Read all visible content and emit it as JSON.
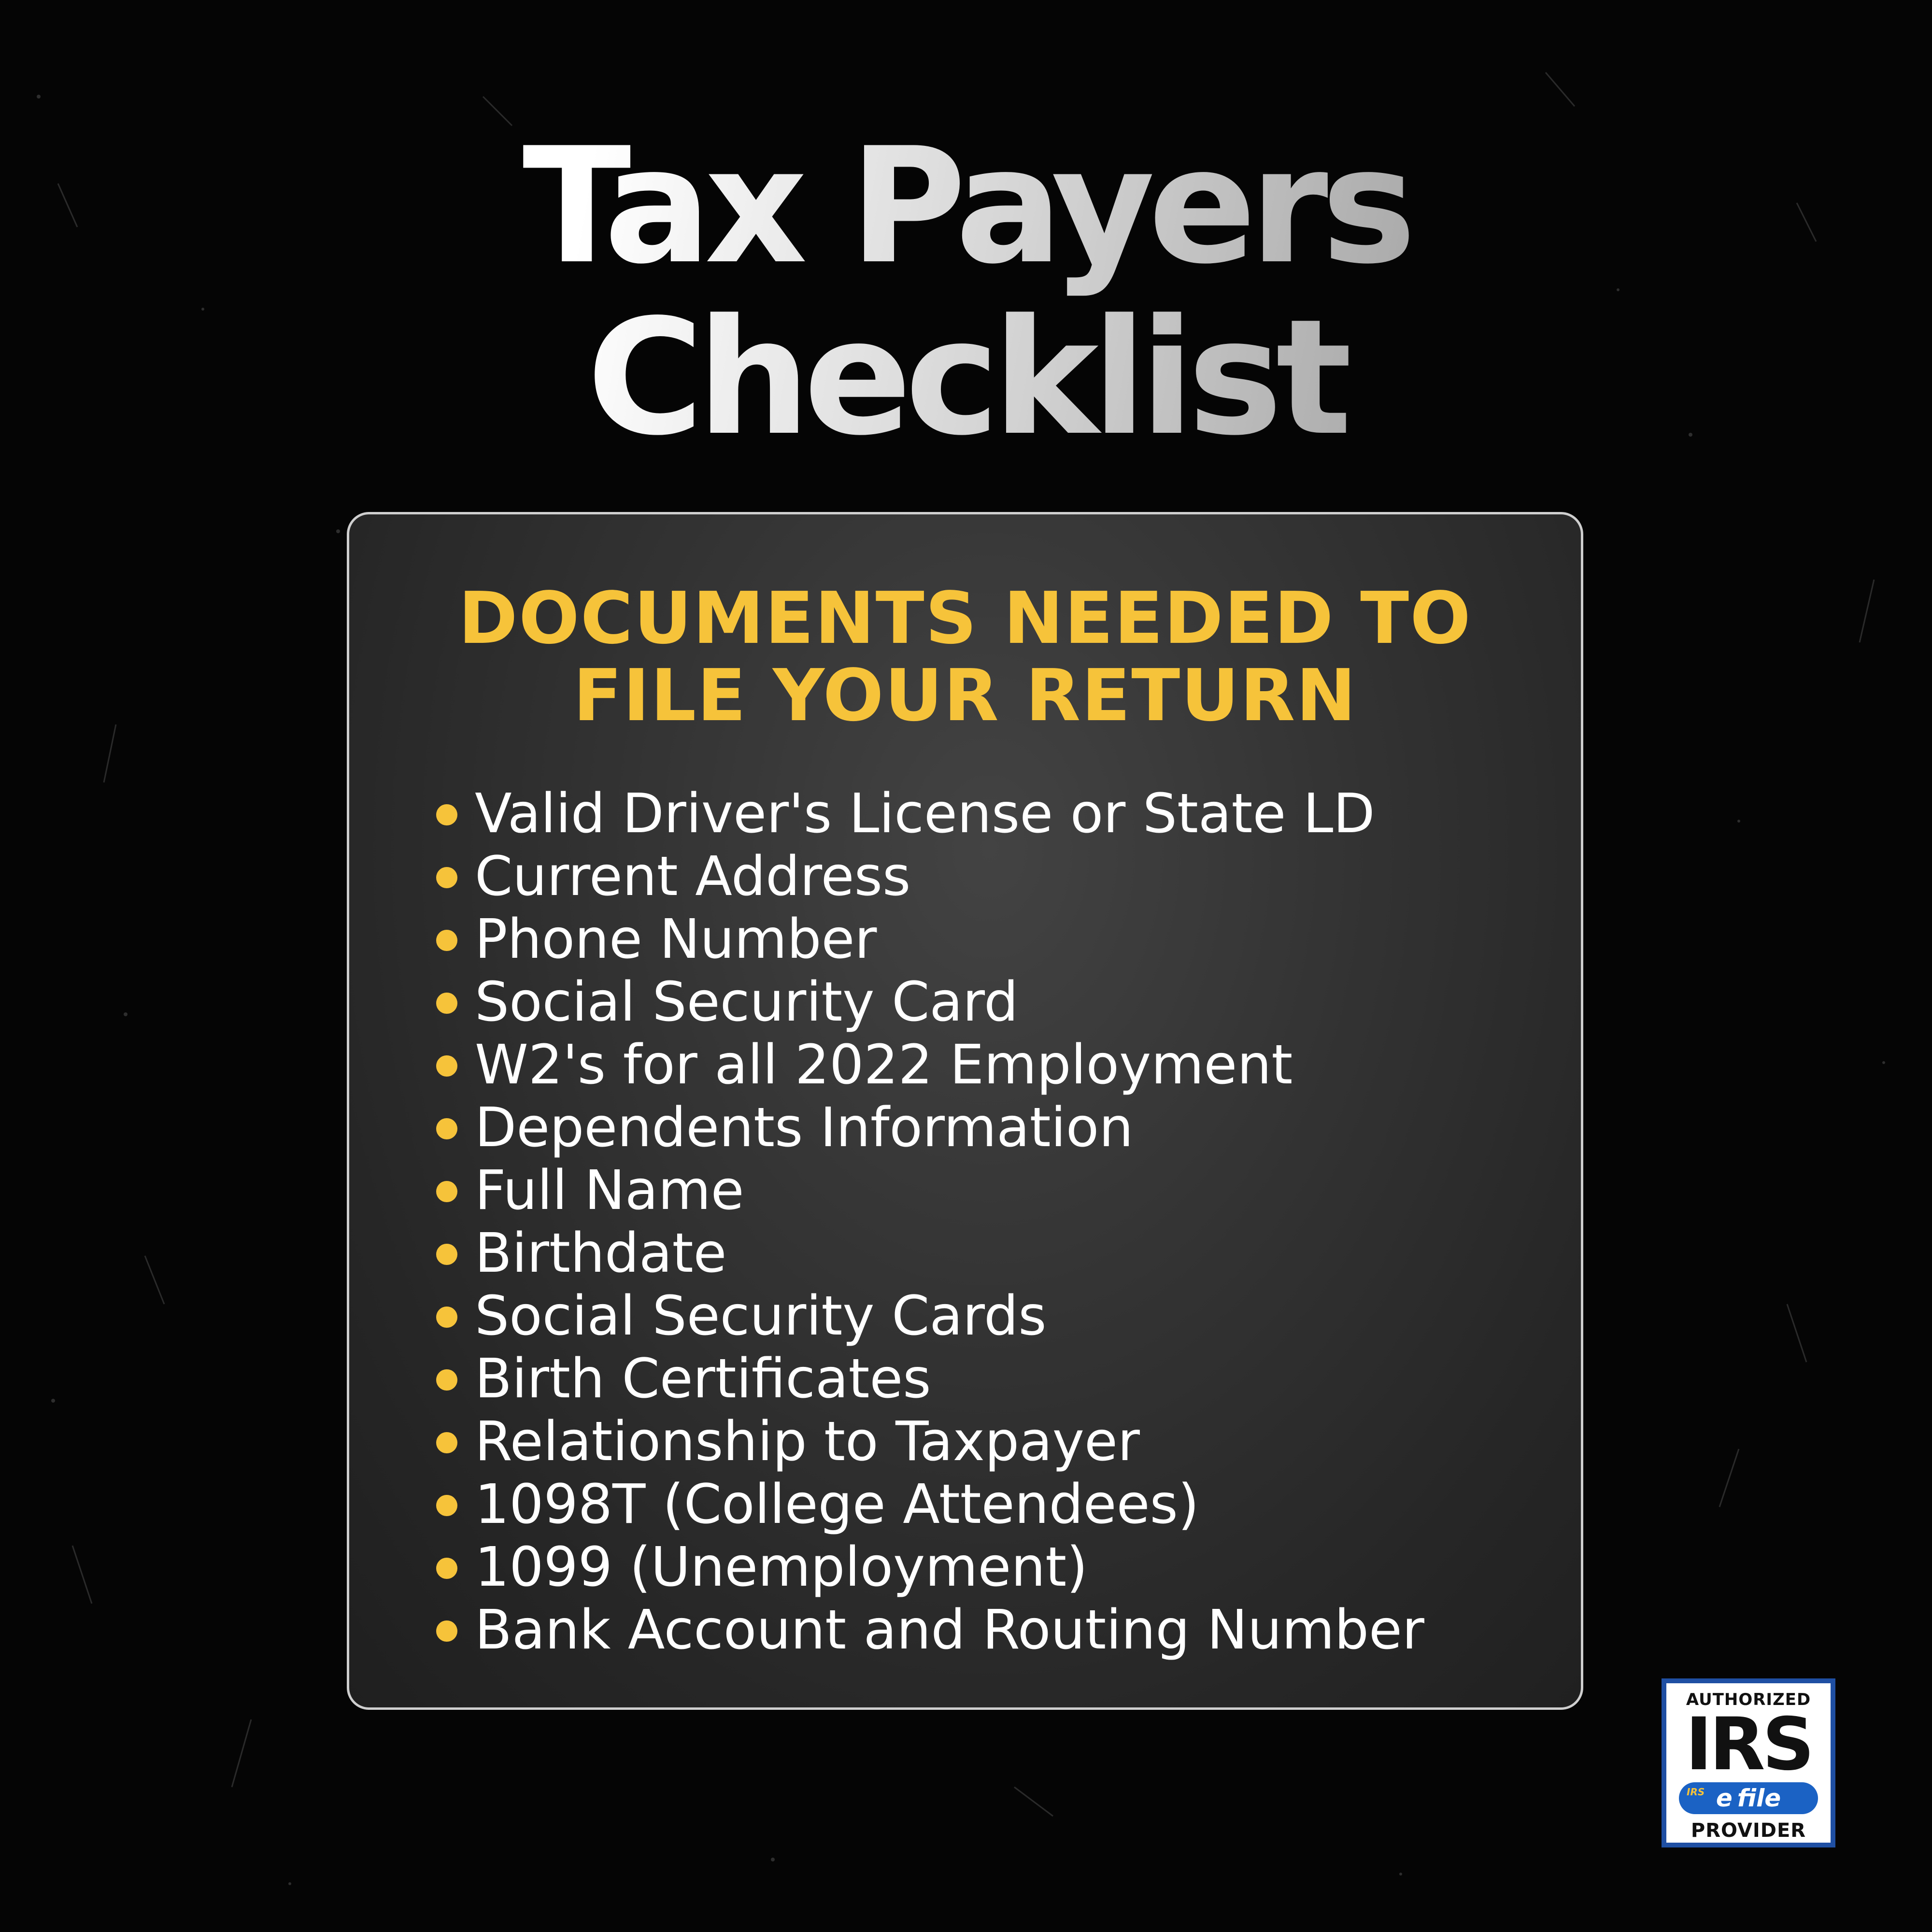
{
  "title": {
    "line1": "Tax Payers",
    "line2": "Checklist"
  },
  "card": {
    "heading_line1": "DOCUMENTS NEEDED TO",
    "heading_line2": "FILE YOUR RETURN",
    "items": [
      "Valid Driver's License or State LD",
      "Current Address",
      "Phone Number",
      "Social Security Card",
      "W2's for all 2022 Employment",
      "Dependents Information",
      "Full Name",
      "Birthdate",
      "Social Security Cards",
      "Birth Certificates",
      "Relationship to Taxpayer",
      "1098T (College Attendees)",
      "1099 (Unemployment)",
      "Bank Account and Routing Number"
    ]
  },
  "badge": {
    "top": "AUTHORIZED",
    "main": "IRS",
    "efile_small": "IRS",
    "efile": "e file",
    "bottom": "PROVIDER"
  },
  "colors": {
    "background": "#050505",
    "accent": "#f6c33a",
    "card": "#333333",
    "badge_blue": "#1f4fa3"
  }
}
